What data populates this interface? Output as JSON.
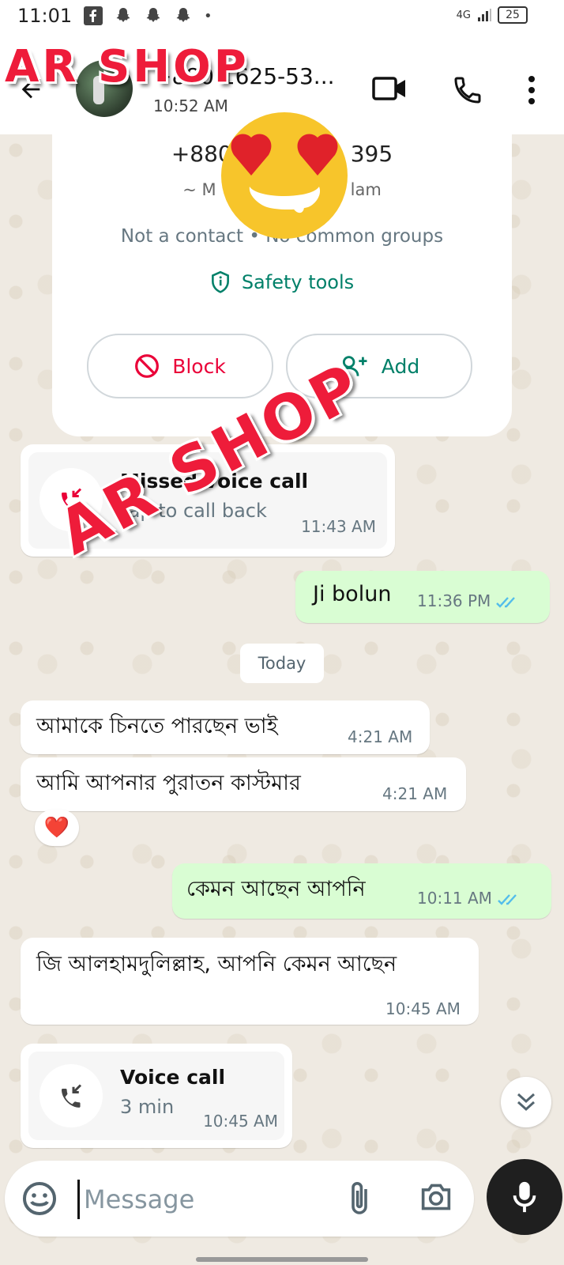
{
  "status_bar": {
    "time": "11:01",
    "network": "4G",
    "battery": "25"
  },
  "header": {
    "contact_name": "+880 1625-53...",
    "subtitle": "10:52 AM"
  },
  "overlay": {
    "watermark_top": "AR SHOP",
    "watermark_mid": "AR SHOP"
  },
  "info_card": {
    "phone": "+880",
    "phone_end": "395",
    "tag_start": "~ M",
    "tag_end": "lam",
    "common": "Not a contact • No common groups",
    "safety_label": "Safety tools",
    "block_label": "Block",
    "add_label": "Add"
  },
  "messages": [
    {
      "type": "missed_call",
      "title": "Missed voice call",
      "subtitle": "Tap to call back",
      "time": "11:43 AM"
    },
    {
      "type": "out",
      "text": "Ji bolun",
      "time": "11:36 PM"
    },
    {
      "type": "date",
      "text": "Today"
    },
    {
      "type": "in",
      "text": "আমাকে চিনতে পারছেন ভাই",
      "time": "4:21 AM"
    },
    {
      "type": "in",
      "text": "আমি আপনার পুরাতন কাস্টমার",
      "time": "4:21 AM",
      "reaction": "❤️"
    },
    {
      "type": "out",
      "text": "কেমন আছেন আপনি",
      "time": "10:11 AM"
    },
    {
      "type": "in",
      "text": "জি আলহামদুলিল্লাহ, আপনি কেমন আছেন",
      "time": "10:45 AM"
    },
    {
      "type": "call",
      "title": "Voice call",
      "subtitle": "3 min",
      "time": "10:45 AM"
    }
  ],
  "composer": {
    "placeholder": "Message"
  },
  "colors": {
    "accent": "#008069",
    "block": "#ea0038",
    "outgoing_bubble": "#d9fdd3",
    "tick_blue": "#53bdeb",
    "wallpaper": "#efeae2"
  },
  "icons": [
    "facebook-icon",
    "snapchat-icon",
    "back-arrow-icon",
    "video-call-icon",
    "phone-icon",
    "more-vert-icon",
    "shield-icon",
    "block-icon",
    "add-person-icon",
    "missed-call-icon",
    "incoming-call-icon",
    "emoji-icon",
    "attach-icon",
    "camera-icon",
    "mic-icon",
    "double-chevron-down-icon"
  ]
}
